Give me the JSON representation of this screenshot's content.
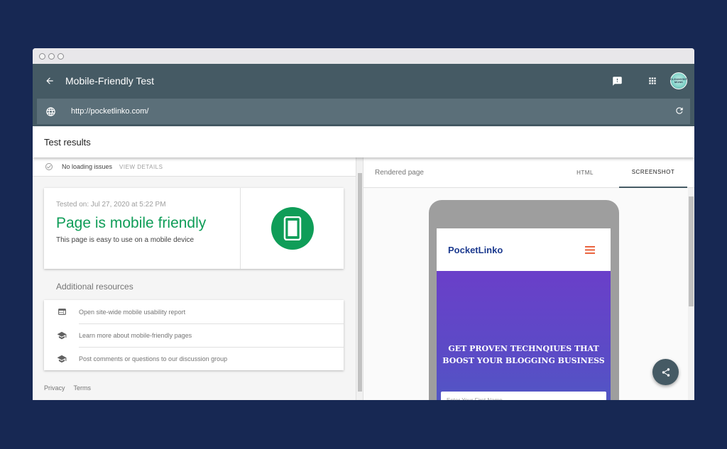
{
  "app": {
    "title": "Mobile-Friendly Test",
    "avatar_text": "CLEANVISIT MONK"
  },
  "urlbar": {
    "url": "http://pocketlinko.com/"
  },
  "results": {
    "title": "Test results",
    "loading_status": "No loading issues",
    "view_details": "VIEW DETAILS",
    "tested_on": "Tested on: Jul 27, 2020 at 5:22 PM",
    "verdict": "Page is mobile friendly",
    "verdict_sub": "This page is easy to use on a mobile device",
    "verdict_color": "#0f9d58",
    "additional_title": "Additional resources",
    "resources": [
      {
        "label": "Open site-wide mobile usability report",
        "icon": "web-icon"
      },
      {
        "label": "Learn more about mobile-friendly pages",
        "icon": "school-icon"
      },
      {
        "label": "Post comments or questions to our discussion group",
        "icon": "school-icon"
      }
    ],
    "footer": {
      "privacy": "Privacy",
      "terms": "Terms"
    }
  },
  "preview": {
    "label": "Rendered page",
    "tabs": [
      {
        "label": "HTML",
        "active": false
      },
      {
        "label": "SCREENSHOT",
        "active": true
      }
    ],
    "site_logo": "PocketLinko",
    "hero_title": "GET PROVEN TECHNQIUES THAT BOOST YOUR BLOGGING BUSINESS",
    "hero_input_placeholder": "Enter Your First Name"
  },
  "colors": {
    "appbar": "#455a64",
    "background": "#172853",
    "accent_green": "#0f9d58"
  }
}
